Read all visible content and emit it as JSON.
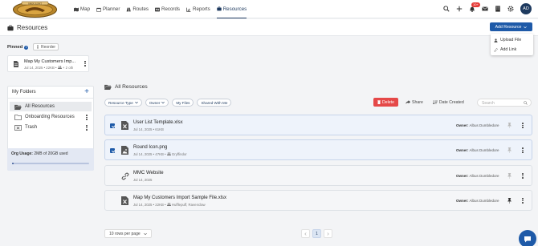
{
  "nav": {
    "logo_text": "SHOULDNT",
    "items": [
      {
        "label": "Map",
        "icon": "map-icon",
        "active": false
      },
      {
        "label": "Planner",
        "icon": "calendar-icon",
        "active": false
      },
      {
        "label": "Routes",
        "icon": "routes-icon",
        "active": false
      },
      {
        "label": "Records",
        "icon": "records-icon",
        "active": false
      },
      {
        "label": "Reports",
        "icon": "reports-icon",
        "active": false
      },
      {
        "label": "Resources",
        "icon": "briefcase-icon",
        "active": true
      }
    ],
    "notification_count": "10+",
    "avatar_initials": "AD"
  },
  "header": {
    "title": "Resources",
    "add_button": "Add Resource",
    "dropdown": [
      "Upload File",
      "Add Link"
    ]
  },
  "pinned": {
    "label": "Pinned",
    "reorder": "Reorder",
    "card": {
      "name": "Map My Customers Imp...",
      "meta": "Jul 14, 2025 • 22KB •",
      "meta_extra": "+ 2 oth"
    }
  },
  "folders": {
    "title": "My Folders",
    "items": [
      {
        "label": "All Resources",
        "active": true
      },
      {
        "label": "Onboarding Resources",
        "active": false
      },
      {
        "label": "Trash",
        "active": false
      }
    ],
    "org_usage_label": "Org Usage:",
    "org_usage_value": "2MB of 20GB used",
    "usage_fraction": 0.01
  },
  "main": {
    "title": "All Resources",
    "filters": [
      "Resource Type",
      "Owner",
      "My Files",
      "Shared With Me"
    ],
    "delete": "Delete",
    "share": "Share",
    "date_created": "Date Created",
    "search_placeholder": "Search"
  },
  "rows": [
    {
      "name": "User List Template.xlsx",
      "meta": "Jul 14, 2025 • 61KB",
      "group": "",
      "owner_label": "Owner:",
      "owner": "Albus Dumbledore",
      "checked": true,
      "type": "excel",
      "pinned": false
    },
    {
      "name": "Round Icon.png",
      "meta": "Jul 14, 2025 • 47KB •",
      "group": "Gryffindor",
      "owner_label": "Owner:",
      "owner": "Albus Dumbledore",
      "checked": true,
      "type": "image",
      "pinned": false
    },
    {
      "name": "MMC Website",
      "meta": "Jul 14, 2025",
      "group": "",
      "owner_label": "Owner:",
      "owner": "Albus Dumbledore",
      "checked": false,
      "type": "link",
      "pinned": false
    },
    {
      "name": "Map My Customers Import Sample File.xlsx",
      "meta": "Jul 14, 2025 • 22KB •",
      "group": "Hufflepuff, Ravenclaw",
      "owner_label": "Owner:",
      "owner": "Albus Dumbledore",
      "checked": false,
      "type": "excel",
      "pinned": true
    }
  ],
  "pagination": {
    "page_size": "10 rows per page",
    "current_page": "1"
  }
}
